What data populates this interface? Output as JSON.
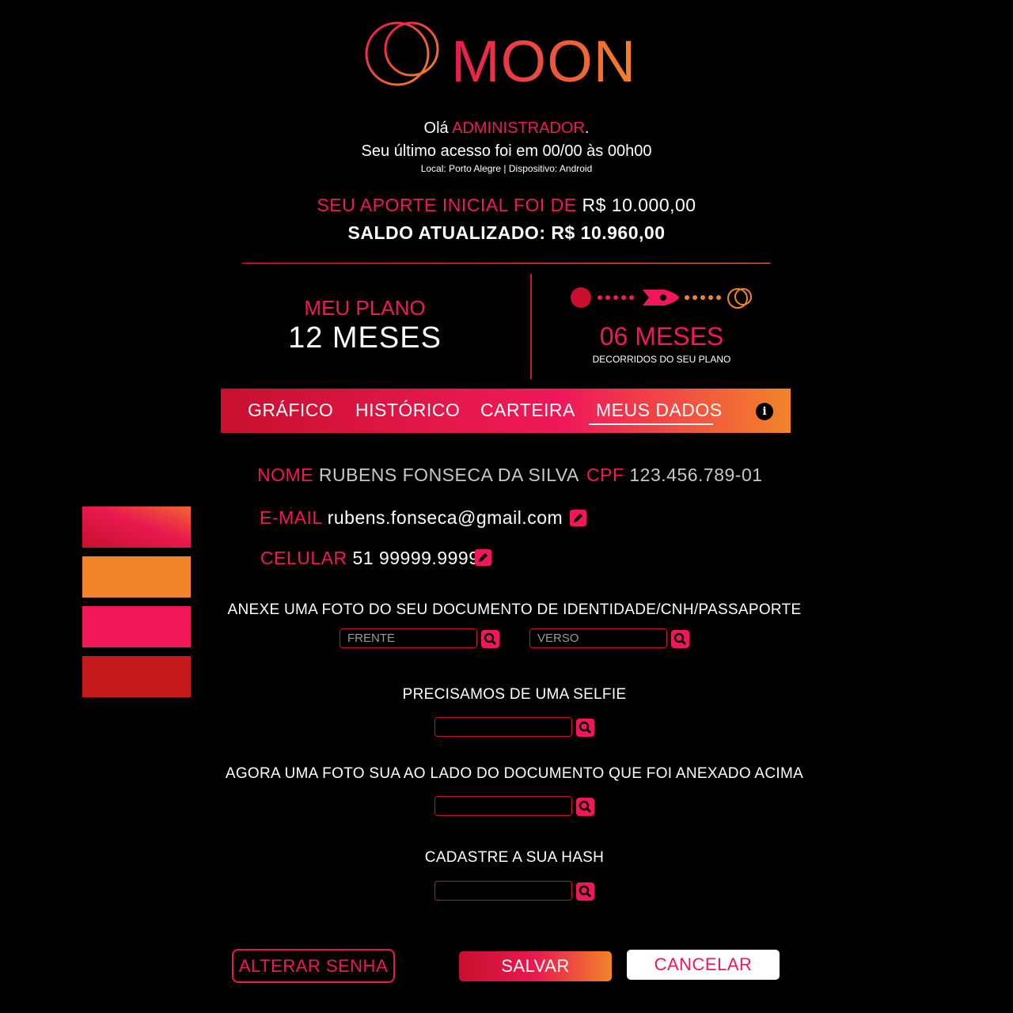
{
  "app": {
    "brand": "MOON"
  },
  "greeting": {
    "hello": "Olá",
    "user": "ADMINISTRADOR",
    "period": ".",
    "last_access": "Seu último acesso foi em 00/00 às 00h00",
    "location": "Local: Porto Alegre | Dispositivo: Android"
  },
  "balance": {
    "aporte_label": "SEU APORTE INICIAL FOI DE",
    "aporte_value": "R$ 10.000,00",
    "saldo": "SALDO ATUALIZADO: R$ 10.960,00"
  },
  "plan": {
    "label": "MEU PLANO",
    "value": "12 MESES",
    "elapsed_value": "06 MESES",
    "elapsed_note": "DECORRIDOS DO SEU PLANO",
    "progress_fraction": 0.5
  },
  "tabs": [
    {
      "label": "GRÁFICO"
    },
    {
      "label": "HISTÓRICO"
    },
    {
      "label": "CARTEIRA"
    },
    {
      "label": "MEUS DADOS",
      "active": true
    }
  ],
  "user": {
    "name_label": "NOME",
    "name": "RUBENS FONSECA DA SILVA",
    "cpf_label": "CPF",
    "cpf": "123.456.789-01",
    "email_label": "E-MAIL",
    "email": "rubens.fonseca@gmail.com",
    "phone_label": "CELULAR",
    "phone": "51 99999.9999"
  },
  "uploads": {
    "document_label": "ANEXE UMA FOTO DO SEU DOCUMENTO DE IDENTIDADE/CNH/PASSAPORTE",
    "front_placeholder": "FRENTE",
    "back_placeholder": "VERSO",
    "selfie_label": "PRECISAMOS DE UMA SELFIE",
    "photo_with_doc_label": "AGORA UMA FOTO SUA AO LADO DO DOCUMENTO QUE FOI ANEXADO ACIMA",
    "hash_label": "CADASTRE A SUA HASH"
  },
  "actions": {
    "change_password": "ALTERAR SENHA",
    "save": "SALVAR",
    "cancel": "CANCELAR"
  },
  "icons": [
    "moon-logo-icon",
    "rocket-icon",
    "info-icon",
    "edit-icon",
    "search-icon"
  ],
  "colors": {
    "background": "#000000",
    "primary": "#f0175a",
    "red": "#c8102e",
    "orange": "#f2842b",
    "swatches": [
      "gradient #e8194f → #f2642f",
      "#f2842b",
      "#f0175a",
      "#c41a1e"
    ]
  }
}
